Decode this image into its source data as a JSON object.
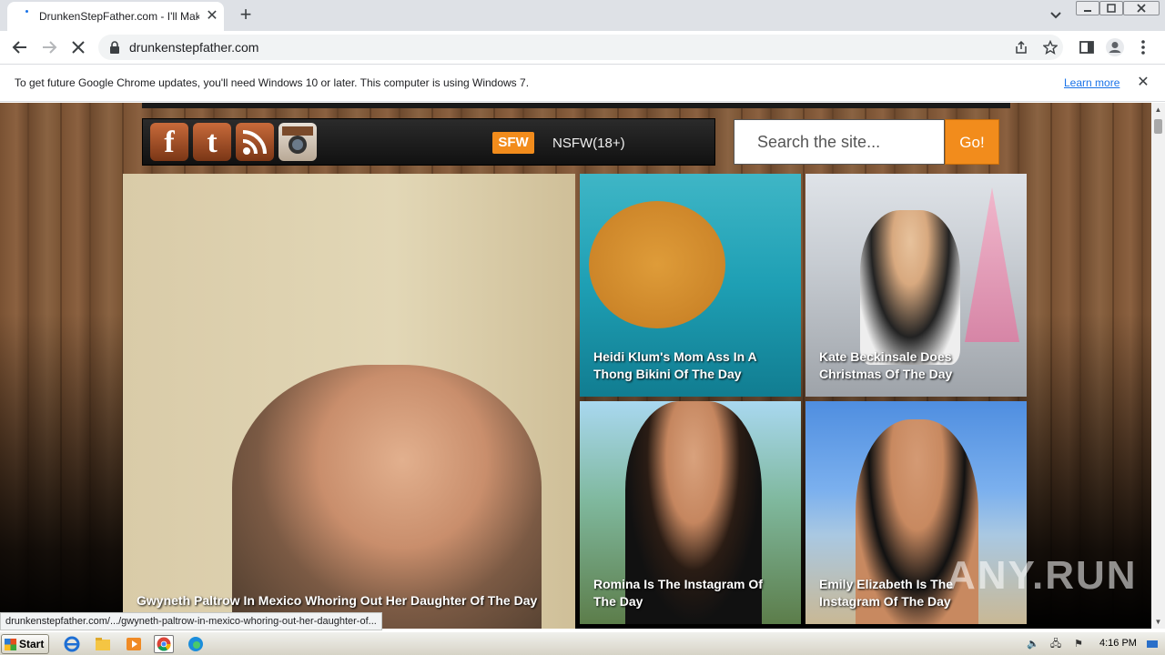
{
  "browser": {
    "tab_title": "DrunkenStepFather.com - I'll Make Y",
    "tab_close": "✕",
    "new_tab": "+",
    "url": "drunkenstepfather.com"
  },
  "infobar": {
    "message": "To get future Google Chrome updates, you'll need Windows 10 or later. This computer is using Windows 7.",
    "learn_more": "Learn more",
    "close": "✕"
  },
  "site": {
    "social": {
      "facebook": "f",
      "twitter": "t"
    },
    "filters": {
      "sfw": "SFW",
      "nsfw": "NSFW(18+)"
    },
    "search": {
      "placeholder": "Search the site...",
      "button": "Go!"
    },
    "cards": [
      {
        "caption": "Gwyneth Paltrow In Mexico Whoring Out Her Daughter Of The Day"
      },
      {
        "caption": "Heidi Klum's Mom Ass In A Thong Bikini Of The Day"
      },
      {
        "caption": "Kate Beckinsale Does Christmas Of The Day"
      },
      {
        "caption": "Romina Is The Instagram Of The Day"
      },
      {
        "caption": "Emily Elizabeth Is The Instagram Of The Day"
      }
    ],
    "watermark": "ANY.RUN"
  },
  "status_url": "drunkenstepfather.com/.../gwyneth-paltrow-in-mexico-whoring-out-her-daughter-of...",
  "taskbar": {
    "start": "Start",
    "clock": "4:16 PM"
  },
  "colors": {
    "accent": "#f28c1c",
    "link": "#1a73e8"
  }
}
